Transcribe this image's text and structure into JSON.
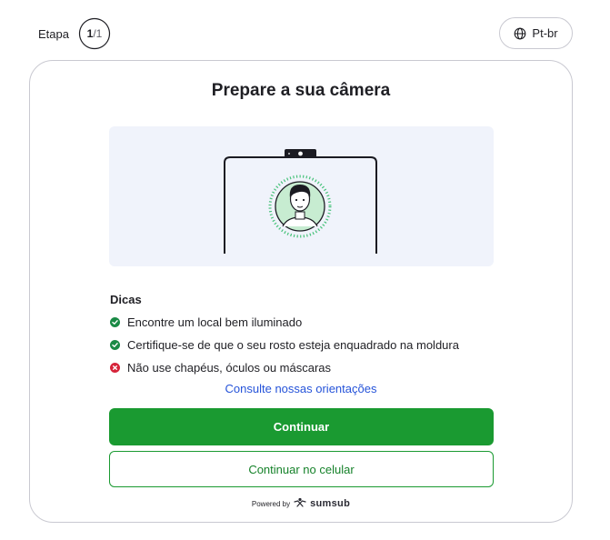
{
  "header": {
    "step_label": "Etapa",
    "step_current": "1",
    "step_total": "/1",
    "language": "Pt-br"
  },
  "card": {
    "title": "Prepare a sua câmera",
    "tips_title": "Dicas",
    "tips": [
      {
        "text": "Encontre um local bem iluminado",
        "status": "ok",
        "icon": "check-circle-icon"
      },
      {
        "text": "Certifique-se de que o seu rosto esteja enquadrado na moldura",
        "status": "ok",
        "icon": "check-circle-icon"
      },
      {
        "text": "Não use chapéus, óculos ou máscaras",
        "status": "error",
        "icon": "x-circle-icon"
      }
    ],
    "guide_link": "Consulte nossas orientações",
    "primary_button": "Continuar",
    "secondary_button": "Continuar no celular",
    "powered_by": "Powered by",
    "brand": "sumsub"
  },
  "colors": {
    "accent_green": "#1a9a31",
    "ok_green": "#1a8a45",
    "error_red": "#d6243a",
    "link_blue": "#2553d9",
    "illustration_bg": "#f0f3fb"
  }
}
